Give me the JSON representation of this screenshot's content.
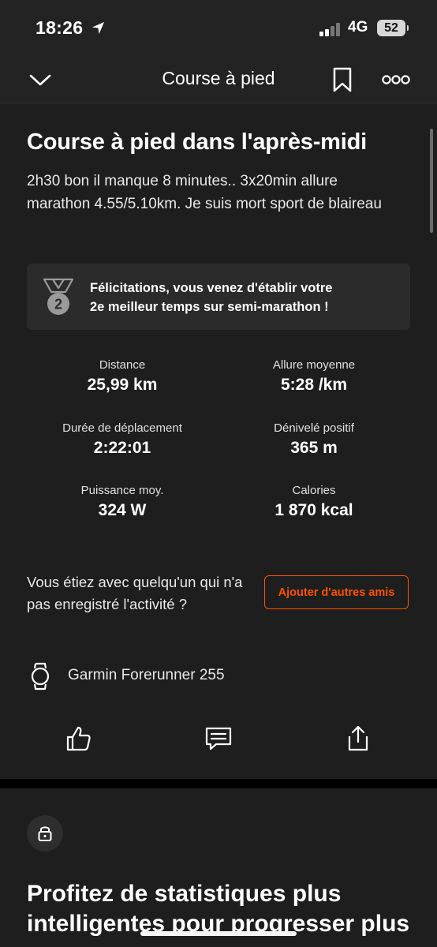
{
  "status_bar": {
    "time": "18:26",
    "network": "4G",
    "battery": "52"
  },
  "nav": {
    "title": "Course à pied",
    "icons": [
      "chevron-down-icon",
      "bookmark-icon",
      "more-icon"
    ]
  },
  "activity": {
    "title": "Course à pied dans l'après-midi",
    "description": "2h30 bon il manque 8 minutes.. 3x20min allure marathon 4.55/5.10km. Je suis mort sport de blaireau"
  },
  "achievement": {
    "medal_number": "2",
    "line1": "Félicitations, vous venez d'établir votre",
    "line2": "2e meilleur temps sur semi-marathon !"
  },
  "stats": [
    {
      "label": "Distance",
      "value": "25,99 km"
    },
    {
      "label": "Allure moyenne",
      "value": "5:28 /km"
    },
    {
      "label": "Durée de déplacement",
      "value": "2:22:01"
    },
    {
      "label": "Dénivelé positif",
      "value": "365 m"
    },
    {
      "label": "Puissance moy.",
      "value": "324 W"
    },
    {
      "label": "Calories",
      "value": "1 870 kcal"
    }
  ],
  "friends": {
    "question": "Vous étiez avec quelqu'un qui n'a pas enregistré l'activité ?",
    "button": "Ajouter d'autres amis"
  },
  "device": {
    "name": "Garmin Forerunner 255"
  },
  "actions": [
    "like-icon",
    "comment-icon",
    "share-icon"
  ],
  "promo": {
    "title": "Profitez de statistiques plus intelligentes pour progresser plus"
  },
  "colors": {
    "accent": "#fc5200",
    "background": "#1e1e1e",
    "panel": "#2b2b2b"
  }
}
